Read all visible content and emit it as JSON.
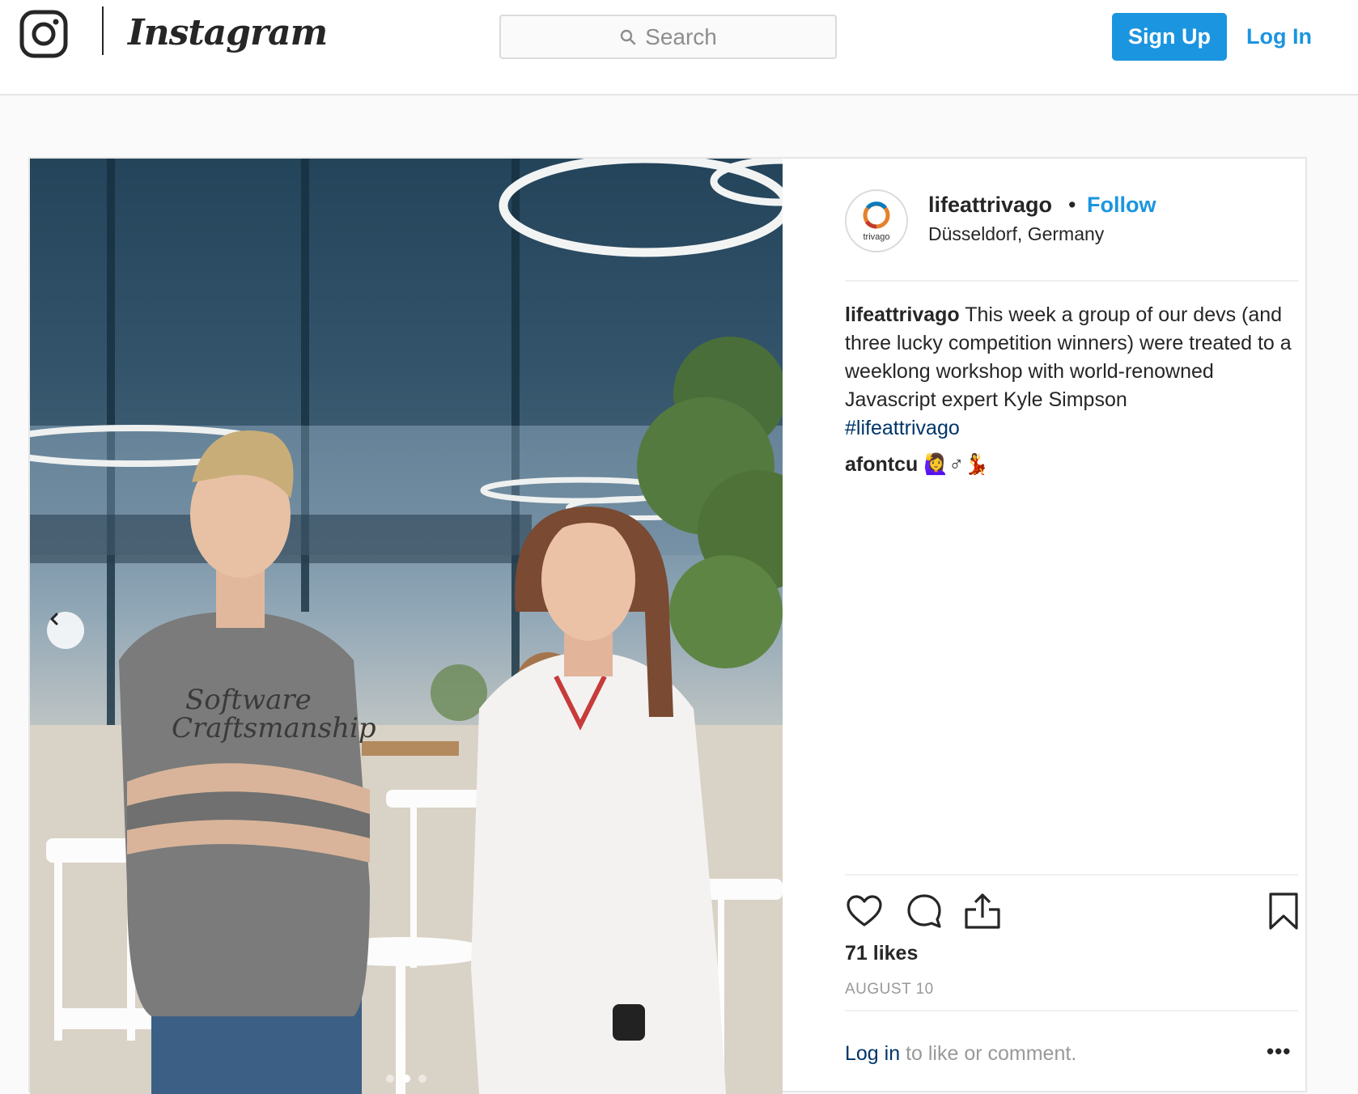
{
  "header": {
    "brand_name": "Instagram",
    "search_placeholder": "Search",
    "signup_label": "Sign Up",
    "login_label": "Log In",
    "icons": [
      "instagram-camera-icon",
      "search-icon"
    ]
  },
  "post": {
    "account": {
      "username": "lifeattrivago",
      "separator": "•",
      "follow_label": "Follow",
      "location": "Düsseldorf, Germany",
      "avatar_text": "trivago"
    },
    "photo": {
      "shirt_text": "Software Craftsmanship",
      "carousel_count": 3,
      "carousel_active_index": 1
    },
    "caption": {
      "username": "lifeattrivago",
      "text": "This week a group of our devs (and three lucky competition winners) were treated to a weeklong workshop with world-renowned Javascript expert Kyle Simpson",
      "hashtag": "#lifeattrivago"
    },
    "comments": [
      {
        "username": "afontcu",
        "text": "🙋‍♀️♂💃"
      }
    ],
    "likes_text": "71 likes",
    "date": "AUGUST 10",
    "login_link": "Log in",
    "login_suffix": "to like or comment.",
    "more_label": "•••",
    "colors": {
      "accent": "#1b95e0",
      "link": "#003569",
      "muted": "#999999"
    }
  }
}
